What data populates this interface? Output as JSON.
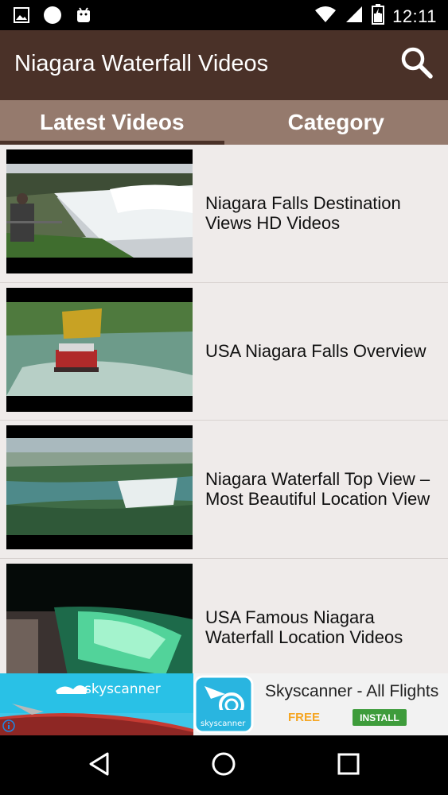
{
  "status_bar": {
    "time": "12:11",
    "left_icons": [
      "image-icon",
      "circle-icon",
      "android-icon"
    ],
    "right_icons": [
      "wifi-icon",
      "signal-icon",
      "battery-icon"
    ]
  },
  "app_bar": {
    "title": "Niagara Waterfall Videos",
    "search_icon": "search-icon"
  },
  "tabs": [
    {
      "label": "Latest Videos",
      "active": true
    },
    {
      "label": "Category",
      "active": false
    }
  ],
  "videos": [
    {
      "title": "Niagara Falls Destination Views HD Videos"
    },
    {
      "title": "USA Niagara Falls Overview"
    },
    {
      "title": "Niagara Waterfall Top View – Most Beautiful Location View"
    },
    {
      "title": "USA Famous Niagara Waterfall Location Videos"
    }
  ],
  "ad": {
    "banner_brand": "skyscanner",
    "icon_brand": "skyscanner",
    "app_name": "Skyscanner - All Flights",
    "price": "FREE",
    "install_label": "INSTALL",
    "info_icon": "info-icon"
  },
  "nav_bar": {
    "buttons": [
      "back-icon",
      "home-icon",
      "recents-icon"
    ]
  },
  "colors": {
    "app_bar": "#4a3128",
    "tab_bar": "#957a6d",
    "list_bg": "#efebea",
    "install_green": "#3e9c3b",
    "free_orange": "#f5a623"
  }
}
